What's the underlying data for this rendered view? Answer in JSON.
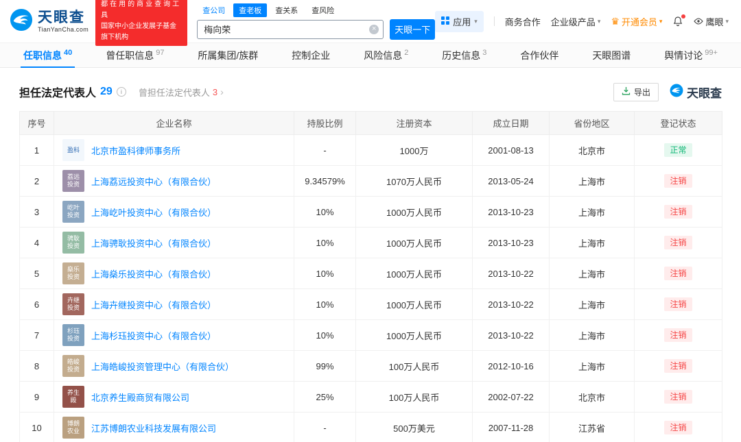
{
  "colors": {
    "brand_blue": "#0084FF",
    "slogan_red": "#F42C2C",
    "vip_orange": "#FF8A00",
    "status_normal_green": "#0BB573",
    "status_cancelled_red": "#F54545",
    "link_blue": "#0084FF"
  },
  "brand": {
    "name": "天眼查",
    "domain": "TianYanCha.com",
    "slogan_line1": "都在用的商业查询工具",
    "slogan_line2": "国家中小企业发展子基金旗下机构"
  },
  "search": {
    "tabs": [
      {
        "id": "company",
        "label": "查公司",
        "active": false,
        "accent": true
      },
      {
        "id": "boss",
        "label": "查老板",
        "active": true,
        "accent": false
      },
      {
        "id": "relation",
        "label": "查关系",
        "active": false,
        "accent": false
      },
      {
        "id": "risk",
        "label": "查风险",
        "active": false,
        "accent": false
      }
    ],
    "input_value": "梅向荣",
    "button_label": "天眼一下"
  },
  "header_menu": {
    "apps_label": "应用",
    "business_label": "商务合作",
    "enterprise_label": "企业级产品",
    "vip_label": "开通会员",
    "eagle_label": "鹰眼"
  },
  "nav_tabs": [
    {
      "id": "position",
      "label": "任职信息",
      "count": "40",
      "active": true
    },
    {
      "id": "former-position",
      "label": "曾任职信息",
      "count": "97",
      "active": false
    },
    {
      "id": "group",
      "label": "所属集团/族群",
      "count": "",
      "active": false
    },
    {
      "id": "control",
      "label": "控制企业",
      "count": "",
      "active": false
    },
    {
      "id": "risk",
      "label": "风险信息",
      "count": "2",
      "active": false
    },
    {
      "id": "history",
      "label": "历史信息",
      "count": "3",
      "active": false
    },
    {
      "id": "partner",
      "label": "合作伙伴",
      "count": "",
      "active": false
    },
    {
      "id": "graph",
      "label": "天眼图谱",
      "count": "",
      "active": false
    },
    {
      "id": "opinion",
      "label": "舆情讨论",
      "count": "99+",
      "active": false
    }
  ],
  "section": {
    "title": "担任法定代表人",
    "title_count": "29",
    "subtitle": "曾担任法定代表人",
    "subtitle_count": "3",
    "export_label": "导出",
    "watermark_text": "天眼查"
  },
  "table": {
    "headers": [
      "序号",
      "企业名称",
      "持股比例",
      "注册资本",
      "成立日期",
      "省份地区",
      "登记状态"
    ],
    "rows": [
      {
        "no": "1",
        "company": "北京市盈科律师事务所",
        "logo": {
          "bg": "#F2F7FC",
          "fg": "#2F6BB3",
          "lines": [
            "盈科"
          ]
        },
        "ratio": "-",
        "capital": "1000万",
        "date": "2001-08-13",
        "region": "北京市",
        "status": "正常",
        "status_type": "normal"
      },
      {
        "no": "2",
        "company": "上海荔远投资中心（有限合伙）",
        "logo": {
          "bg": "#9D8FA9",
          "fg": "#FFFFFF",
          "lines": [
            "荔远",
            "投资"
          ]
        },
        "ratio": "9.34579%",
        "capital": "1070万人民币",
        "date": "2013-05-24",
        "region": "上海市",
        "status": "注销",
        "status_type": "cancelled"
      },
      {
        "no": "3",
        "company": "上海屹叶投资中心（有限合伙）",
        "logo": {
          "bg": "#8BA6C1",
          "fg": "#FFFFFF",
          "lines": [
            "屹叶",
            "投资"
          ]
        },
        "ratio": "10%",
        "capital": "1000万人民币",
        "date": "2013-10-23",
        "region": "上海市",
        "status": "注销",
        "status_type": "cancelled"
      },
      {
        "no": "4",
        "company": "上海骋耿投资中心（有限合伙）",
        "logo": {
          "bg": "#94BCA4",
          "fg": "#FFFFFF",
          "lines": [
            "骋耿",
            "投资"
          ]
        },
        "ratio": "10%",
        "capital": "1000万人民币",
        "date": "2013-10-23",
        "region": "上海市",
        "status": "注销",
        "status_type": "cancelled"
      },
      {
        "no": "5",
        "company": "上海燊乐投资中心（有限合伙）",
        "logo": {
          "bg": "#C4AE92",
          "fg": "#FFFFFF",
          "lines": [
            "燊乐",
            "投资"
          ]
        },
        "ratio": "10%",
        "capital": "1000万人民币",
        "date": "2013-10-22",
        "region": "上海市",
        "status": "注销",
        "status_type": "cancelled"
      },
      {
        "no": "6",
        "company": "上海卉继投资中心（有限合伙）",
        "logo": {
          "bg": "#A2675E",
          "fg": "#FFFFFF",
          "lines": [
            "卉继",
            "投资"
          ]
        },
        "ratio": "10%",
        "capital": "1000万人民币",
        "date": "2013-10-22",
        "region": "上海市",
        "status": "注销",
        "status_type": "cancelled"
      },
      {
        "no": "7",
        "company": "上海杉珏投资中心（有限合伙）",
        "logo": {
          "bg": "#7FA1BE",
          "fg": "#FFFFFF",
          "lines": [
            "杉珏",
            "投资"
          ]
        },
        "ratio": "10%",
        "capital": "1000万人民币",
        "date": "2013-10-22",
        "region": "上海市",
        "status": "注销",
        "status_type": "cancelled"
      },
      {
        "no": "8",
        "company": "上海皓峻投资管理中心（有限合伙）",
        "logo": {
          "bg": "#C3AC8E",
          "fg": "#FFFFFF",
          "lines": [
            "皓峻",
            "投资"
          ]
        },
        "ratio": "99%",
        "capital": "100万人民币",
        "date": "2012-10-16",
        "region": "上海市",
        "status": "注销",
        "status_type": "cancelled"
      },
      {
        "no": "9",
        "company": "北京养生殿商贸有限公司",
        "logo": {
          "bg": "#935149",
          "fg": "#FFFFFF",
          "lines": [
            "养生",
            "殿"
          ]
        },
        "ratio": "25%",
        "capital": "100万人民币",
        "date": "2002-07-22",
        "region": "北京市",
        "status": "注销",
        "status_type": "cancelled"
      },
      {
        "no": "10",
        "company": "江苏博朗农业科技发展有限公司",
        "logo": {
          "bg": "#BAA080",
          "fg": "#FFFFFF",
          "lines": [
            "博朗",
            "农业"
          ]
        },
        "ratio": "-",
        "capital": "500万美元",
        "date": "2007-11-28",
        "region": "江苏省",
        "status": "注销",
        "status_type": "cancelled"
      }
    ]
  }
}
